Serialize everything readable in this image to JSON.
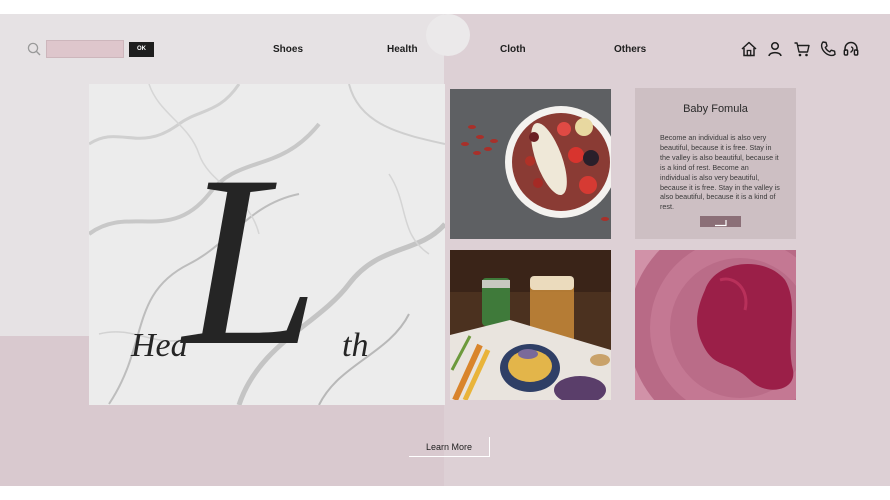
{
  "header": {
    "search": {
      "icon": "search-icon",
      "value": "",
      "placeholder": ""
    },
    "ok_label": "OK",
    "nav": [
      "Shoes",
      "Health",
      "Cloth",
      "Others"
    ],
    "icons": [
      "home-icon",
      "user-icon",
      "cart-icon",
      "phone-icon",
      "headset-icon"
    ]
  },
  "hero": {
    "script_prefix": "Hea",
    "script_letter": "L",
    "script_suffix": "th"
  },
  "card": {
    "title": "Baby Fomula",
    "body": "Become an individual is also very beautiful, because it is free. Stay in the valley is also beautiful, because it is a kind of rest. Become an individual is also very beautiful, because it is free. Stay in the valley is also beautiful, because it is a kind of rest.",
    "button_icon": "arrow-return-icon"
  },
  "cta": {
    "label": "Learn More"
  },
  "colors": {
    "page_background": "#d9c9cf",
    "left_panel": "#e6e2e4",
    "search_field": "#dec6cc",
    "card": "#cdbfc3",
    "card_button": "#8b6f77",
    "text_dark": "#1e1e1e"
  }
}
